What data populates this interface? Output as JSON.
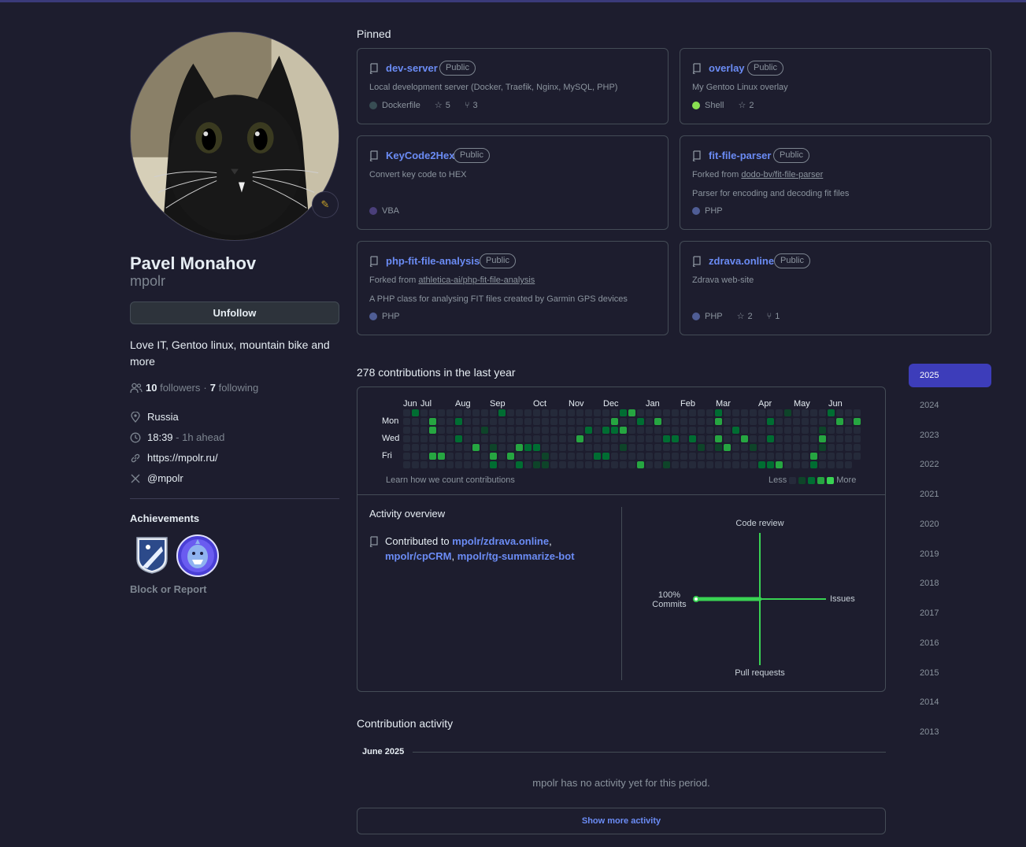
{
  "profile": {
    "name": "Pavel Monahov",
    "login": "mpolr",
    "unfollow_label": "Unfollow",
    "bio": "Love IT, Gentoo linux, mountain bike and more",
    "followers_count": "10",
    "followers_label": "followers",
    "following_count": "7",
    "following_label": "following",
    "location": "Russia",
    "local_time": "18:39",
    "time_offset": "- 1h ahead",
    "website": "https://mpolr.ru/",
    "twitter": "@mpolr",
    "achievements_title": "Achievements",
    "block_report": "Block or Report"
  },
  "pinned": {
    "title": "Pinned",
    "repos": [
      {
        "name": "dev-server",
        "visibility": "Public",
        "forked_from": "",
        "description": "Local development server (Docker, Traefik, Nginx, MySQL, PHP)",
        "language": "Dockerfile",
        "lang_color": "#384d54",
        "stars": "5",
        "forks": "3"
      },
      {
        "name": "overlay",
        "visibility": "Public",
        "forked_from": "",
        "description": "My Gentoo Linux overlay",
        "language": "Shell",
        "lang_color": "#89e051",
        "stars": "2",
        "forks": ""
      },
      {
        "name": "KeyCode2Hex",
        "visibility": "Public",
        "forked_from": "",
        "description": "Convert key code to HEX",
        "language": "VBA",
        "lang_color": "#4a3f7a",
        "stars": "",
        "forks": ""
      },
      {
        "name": "fit-file-parser",
        "visibility": "Public",
        "forked_prefix": "Forked from",
        "forked_from": "dodo-bv/fit-file-parser",
        "description": "Parser for encoding and decoding fit files",
        "language": "PHP",
        "lang_color": "#4F5D95",
        "stars": "",
        "forks": ""
      },
      {
        "name": "php-fit-file-analysis",
        "visibility": "Public",
        "forked_prefix": "Forked from",
        "forked_from": "athletica-ai/php-fit-file-analysis",
        "description": "A PHP class for analysing FIT files created by Garmin GPS devices",
        "language": "PHP",
        "lang_color": "#4F5D95",
        "stars": "",
        "forks": ""
      },
      {
        "name": "zdrava.online",
        "visibility": "Public",
        "forked_from": "",
        "description": "Zdrava web-site",
        "language": "PHP",
        "lang_color": "#4F5D95",
        "stars": "2",
        "forks": "1"
      }
    ]
  },
  "contributions": {
    "title": "278 contributions in the last year",
    "months": [
      "Jun",
      "Jul",
      "Aug",
      "Sep",
      "Oct",
      "Nov",
      "Dec",
      "Jan",
      "Feb",
      "Mar",
      "Apr",
      "May",
      "Jun"
    ],
    "days": [
      "Mon",
      "Wed",
      "Fri"
    ],
    "learn_label": "Learn how we count contributions",
    "legend_less": "Less",
    "legend_more": "More",
    "colors": [
      "#252a3a",
      "#0e4429",
      "#006d32",
      "#26a641",
      "#39d353"
    ]
  },
  "overview": {
    "title": "Activity overview",
    "contributed_prefix": "Contributed to",
    "repos": [
      "mpolr/zdrava.online",
      "mpolr/cpCRM",
      "mpolr/tg-summarize-bot"
    ],
    "code_review": "Code review",
    "issues": "Issues",
    "pull_requests": "Pull requests",
    "commits_pct": "100%",
    "commits": "Commits"
  },
  "activity": {
    "title": "Contribution activity",
    "month": "June 2025",
    "empty": "mpolr has no activity yet for this period.",
    "show_more": "Show more activity"
  },
  "years": [
    "2025",
    "2024",
    "2023",
    "2022",
    "2021",
    "2020",
    "2019",
    "2018",
    "2017",
    "2016",
    "2015",
    "2014",
    "2013"
  ]
}
